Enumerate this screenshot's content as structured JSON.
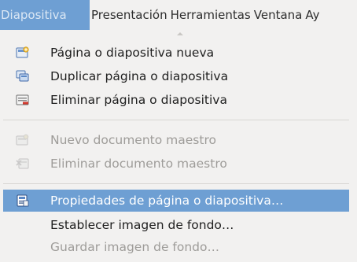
{
  "menubar": {
    "items": [
      {
        "label": "Diapositiva",
        "active": true
      },
      {
        "label": "Presentación"
      },
      {
        "label": "Herramientas"
      },
      {
        "label": "Ventana"
      },
      {
        "label": "Ay"
      }
    ]
  },
  "menu": {
    "items": [
      {
        "label": "Página o diapositiva nueva",
        "icon": "new-slide-icon",
        "enabled": true
      },
      {
        "label": "Duplicar página o diapositiva",
        "icon": "duplicate-slide-icon",
        "enabled": true
      },
      {
        "label": "Eliminar página o diapositiva",
        "icon": "delete-slide-icon",
        "enabled": true
      },
      {
        "label": "Nuevo documento maestro",
        "icon": "new-master-icon",
        "enabled": false
      },
      {
        "label": "Eliminar documento maestro",
        "icon": "delete-master-icon",
        "enabled": false
      },
      {
        "label": "Propiedades de página o diapositiva…",
        "icon": "slide-properties-icon",
        "enabled": true,
        "highlighted": true
      },
      {
        "label": "Establecer imagen de fondo…",
        "icon": "",
        "enabled": true
      },
      {
        "label": "Guardar imagen de fondo…",
        "icon": "",
        "enabled": false
      }
    ]
  },
  "colors": {
    "highlight": "#6e9fd3",
    "background": "#f2f1f0",
    "disabled_text": "#9e9c99"
  }
}
